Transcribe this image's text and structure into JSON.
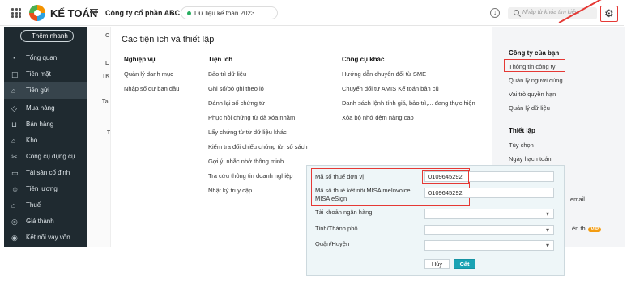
{
  "header": {
    "brand": "KẾ TOÁN",
    "company": "Công ty cổ phần ABC",
    "company_chevron": "∨",
    "database": "Dữ liệu kế toán 2023",
    "search_placeholder": "Nhập từ khóa tìm kiếm"
  },
  "sidebar": {
    "add_button": "+ Thêm nhanh",
    "items": [
      {
        "label": "Tổng quan",
        "icon": "dashboard-icon"
      },
      {
        "label": "Tiền mặt",
        "icon": "cash-icon"
      },
      {
        "label": "Tiền gửi",
        "icon": "bank-icon"
      },
      {
        "label": "Mua hàng",
        "icon": "purchase-icon"
      },
      {
        "label": "Bán hàng",
        "icon": "cart-icon"
      },
      {
        "label": "Kho",
        "icon": "warehouse-icon"
      },
      {
        "label": "Công cụ dụng cụ",
        "icon": "tools-icon"
      },
      {
        "label": "Tài sản cố định",
        "icon": "asset-icon"
      },
      {
        "label": "Tiền lương",
        "icon": "salary-icon"
      },
      {
        "label": "Thuế",
        "icon": "tax-icon"
      },
      {
        "label": "Giá thành",
        "icon": "cost-icon"
      },
      {
        "label": "Kết nối vay vốn",
        "icon": "loan-icon"
      }
    ]
  },
  "background": {
    "fragments": [
      "C",
      "L",
      "TK",
      "Ta",
      "T"
    ]
  },
  "panel": {
    "title": "Các tiện ích và thiết lập",
    "columns": [
      {
        "heading": "Nghiệp vụ",
        "items": [
          "Quản lý danh mục",
          "Nhập số dư ban đầu"
        ]
      },
      {
        "heading": "Tiện ích",
        "items": [
          "Bảo trì dữ liệu",
          "Ghi sổ/bỏ ghi theo lô",
          "Đánh lại số chứng từ",
          "Phục hồi chứng từ đã xóa nhầm",
          "Lấy chứng từ từ dữ liệu khác",
          "Kiểm tra đối chiếu chứng từ, sổ sách",
          "Gợi ý, nhắc nhở thông minh",
          "Tra cứu thông tin doanh nghiệp",
          "Nhật ký truy cập"
        ]
      },
      {
        "heading": "Công cụ khác",
        "items": [
          "Hướng dẫn chuyển đổi từ SME",
          "Chuyển đổi từ AMIS Kế toán bản cũ",
          "Danh sách lệnh tính giá, bảo trì,... đang thực hiện",
          "Xóa bộ nhớ đệm nâng cao"
        ]
      }
    ]
  },
  "right_panel": {
    "company_heading": "Công ty của bạn",
    "company_items": [
      "Thông tin công ty",
      "Quản lý người dùng",
      "Vai trò quyền hạn",
      "Quản lý dữ liệu"
    ],
    "setup_heading": "Thiết lập",
    "setup_items": [
      "Tùy chọn",
      "Ngày hạch toán"
    ],
    "partial_items": [
      "email",
      "ền thị"
    ],
    "vip": "VIP"
  },
  "form": {
    "fields": [
      {
        "label": "Mã số thuế đơn vị",
        "value": "0109645292"
      },
      {
        "label": "Mã số thuế kết nối MISA meInvoice, MISA eSign",
        "value": "0109645292"
      },
      {
        "label": "Tài khoản ngân hàng",
        "value": ""
      },
      {
        "label": "Tỉnh/Thành phố",
        "value": ""
      },
      {
        "label": "Quận/Huyện",
        "value": ""
      }
    ],
    "cancel": "Hủy",
    "save": "Cất"
  }
}
